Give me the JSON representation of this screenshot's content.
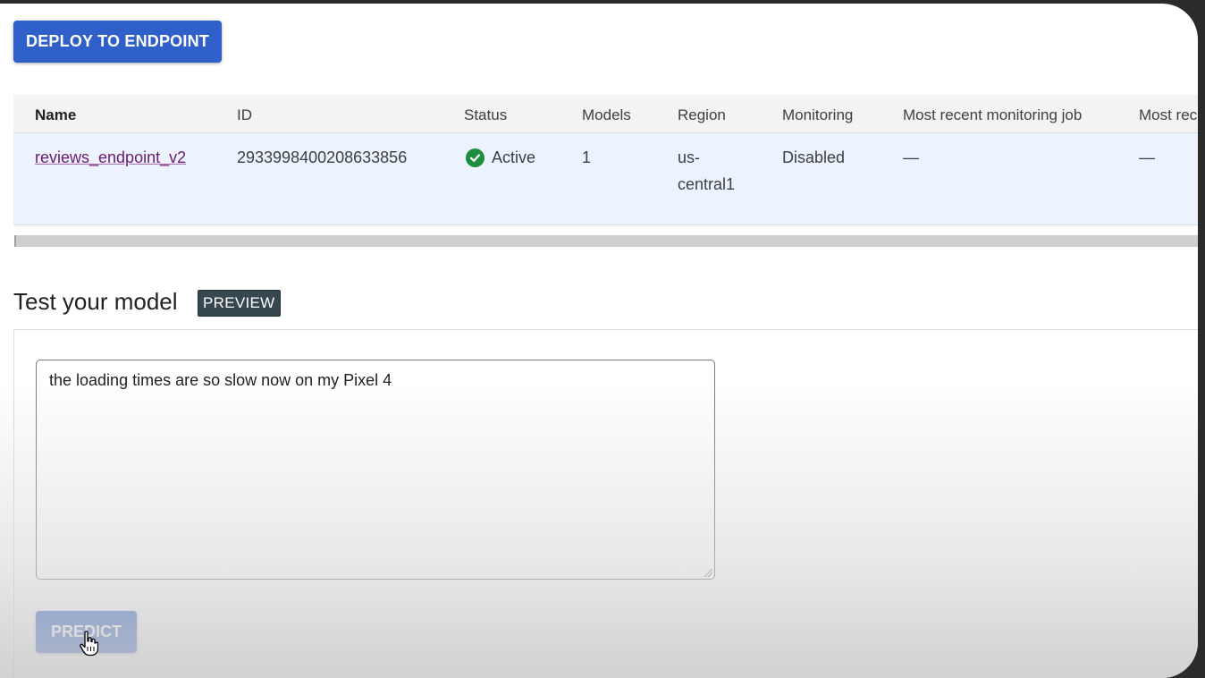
{
  "toolbar": {
    "deploy_label": "DEPLOY TO ENDPOINT"
  },
  "table": {
    "columns": [
      "Name",
      "ID",
      "Status",
      "Models",
      "Region",
      "Monitoring",
      "Most recent monitoring job",
      "Most rec"
    ],
    "rows": [
      {
        "name": "reviews_endpoint_v2",
        "id": "2933998400208633856",
        "status": "Active",
        "models": "1",
        "region_line1": "us-",
        "region_line2": "central1",
        "monitoring": "Disabled",
        "recent_job": "—",
        "most_rec": "—"
      }
    ]
  },
  "test_section": {
    "title": "Test your model",
    "badge": "PREVIEW",
    "input_value": "the loading times are so slow now on my Pixel 4",
    "predict_label": "PREDICT"
  },
  "colors": {
    "primary_button": "#2f5fc9",
    "status_active": "#1e8e3e",
    "link": "#6a1b6f",
    "row_highlight": "#edf3fe"
  },
  "icons": {
    "status": "check-circle-icon",
    "cursor": "hand-pointer-icon"
  }
}
